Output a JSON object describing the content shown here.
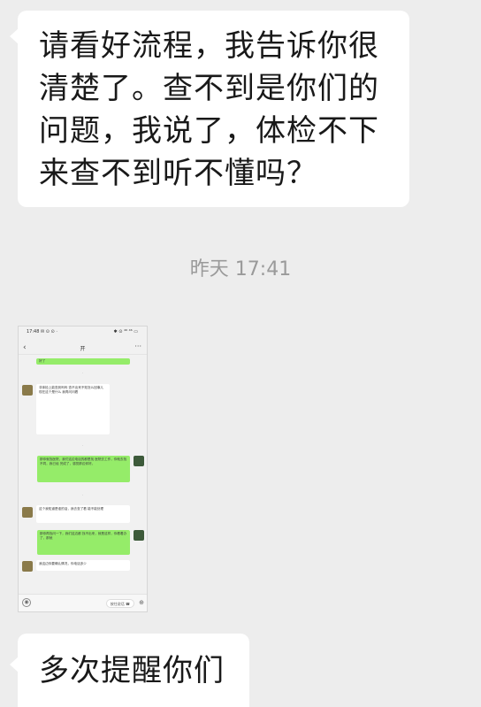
{
  "messages": [
    {
      "type": "text",
      "lines": [
        "请看好流程，我告诉你很",
        "清楚了。查不到是你们的",
        "问题，我说了，体检不下",
        "来查不到听不懂吗？"
      ]
    },
    {
      "type": "time",
      "text": "昨天 17:41"
    },
    {
      "type": "image",
      "screenshot": {
        "status_left": "17:48 ✉ ⊙ ⊙ ·",
        "status_right": "✱ ⊙ ⁴⁶ ⁴⁶ ▭",
        "back_icon": "‹",
        "contact_name": "开",
        "more_icon": "···",
        "rows": [
          {
            "side": "right",
            "color": "green",
            "text": "好了"
          },
          {
            "side": "left",
            "color": "white",
            "text": "非体检上能查到吗吗 查不出来不知怎么回事儿 现在这个是什么 我再问问看"
          },
          {
            "side": "right",
            "color": "green",
            "text": "那你就找医院，我们这边电话的都是找 医院去工作，你就去找不同，我已经 完成了，感觉那边你好。"
          },
          {
            "side": "left",
            "color": "white",
            "text": "这个我知道是谁的话，我去查了看 能不能处理"
          },
          {
            "side": "right",
            "color": "green",
            "text": "那你再找问一下，我们这边都 找不出来，就是这样，你看着办 了，那就"
          },
          {
            "side": "left",
            "color": "white",
            "text": "我这边你要确认情况，你电话多少"
          }
        ],
        "input_chip": "按住说话 ☎",
        "voice_icon": "◉",
        "plus_icon": "⊕"
      }
    },
    {
      "type": "text",
      "lines": [
        "多次提醒你们"
      ]
    }
  ],
  "colors": {
    "chat_bg": "#ededed",
    "bubble_white": "#ffffff",
    "bubble_green": "#95ec69",
    "time_text": "#9a9a9a"
  }
}
